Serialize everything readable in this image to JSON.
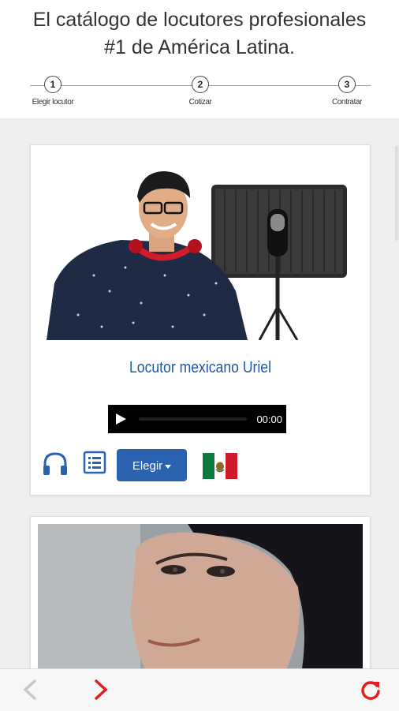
{
  "header": {
    "tagline_line1": "El catálogo de locutores profesionales",
    "tagline_line2": "#1 de América Latina."
  },
  "steps": [
    {
      "number": "1",
      "label": "Elegir locutor"
    },
    {
      "number": "2",
      "label": "Cotizar"
    },
    {
      "number": "3",
      "label": "Contratar"
    }
  ],
  "cards": [
    {
      "name": "Locutor mexicano Uriel",
      "player_time": "00:00",
      "choose_label": "Elegir",
      "flag": "mexico-flag",
      "icons": [
        "headphones-icon",
        "list-icon"
      ]
    }
  ],
  "nav": {
    "back_icon": "chevron-left-icon",
    "forward_icon": "chevron-right-icon",
    "reload_icon": "refresh-icon"
  },
  "colors": {
    "accent_blue": "#2a62b0",
    "name_blue": "#1f5aa0",
    "nav_red": "#e02020",
    "disabled_gray": "#c8c8c8"
  }
}
